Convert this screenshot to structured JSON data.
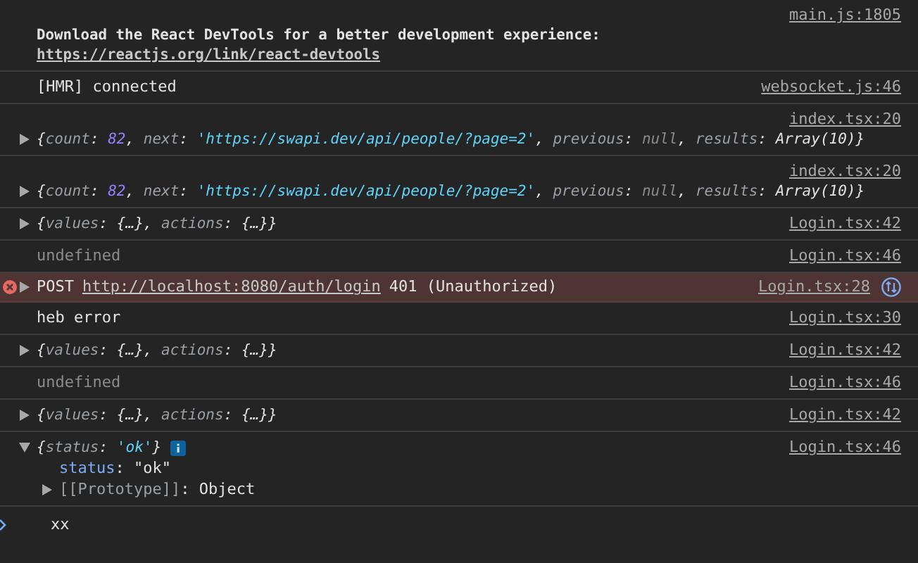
{
  "console": {
    "messages": [
      {
        "kind": "text",
        "bold": true,
        "source": "main.js:1805",
        "text": "Download the React DevTools for a better development experience:",
        "link": "https://reactjs.org/link/react-devtools"
      },
      {
        "kind": "text",
        "bold": false,
        "source": "websocket.js:46",
        "text": "[HMR] connected"
      },
      {
        "kind": "object",
        "expanded": false,
        "source": "index.tsx:20",
        "segments": [
          {
            "text": "{",
            "kind": "punct"
          },
          {
            "text": "count",
            "kind": "key"
          },
          {
            "text": ": ",
            "kind": "punct"
          },
          {
            "text": "82",
            "kind": "number"
          },
          {
            "text": ", ",
            "kind": "punct"
          },
          {
            "text": "next",
            "kind": "key"
          },
          {
            "text": ": ",
            "kind": "punct"
          },
          {
            "text": "'https://swapi.dev/api/people/?page=2'",
            "kind": "string"
          },
          {
            "text": ", ",
            "kind": "punct"
          },
          {
            "text": "previous",
            "kind": "key"
          },
          {
            "text": ": ",
            "kind": "punct"
          },
          {
            "text": "null",
            "kind": "null"
          },
          {
            "text": ", ",
            "kind": "punct"
          },
          {
            "text": "results",
            "kind": "key"
          },
          {
            "text": ": ",
            "kind": "punct"
          },
          {
            "text": "Array(10)",
            "kind": "punct"
          },
          {
            "text": "}",
            "kind": "punct"
          }
        ]
      },
      {
        "kind": "object",
        "expanded": false,
        "source": "index.tsx:20",
        "segments": [
          {
            "text": "{",
            "kind": "punct"
          },
          {
            "text": "count",
            "kind": "key"
          },
          {
            "text": ": ",
            "kind": "punct"
          },
          {
            "text": "82",
            "kind": "number"
          },
          {
            "text": ", ",
            "kind": "punct"
          },
          {
            "text": "next",
            "kind": "key"
          },
          {
            "text": ": ",
            "kind": "punct"
          },
          {
            "text": "'https://swapi.dev/api/people/?page=2'",
            "kind": "string"
          },
          {
            "text": ", ",
            "kind": "punct"
          },
          {
            "text": "previous",
            "kind": "key"
          },
          {
            "text": ": ",
            "kind": "punct"
          },
          {
            "text": "null",
            "kind": "null"
          },
          {
            "text": ", ",
            "kind": "punct"
          },
          {
            "text": "results",
            "kind": "key"
          },
          {
            "text": ": ",
            "kind": "punct"
          },
          {
            "text": "Array(10)",
            "kind": "punct"
          },
          {
            "text": "}",
            "kind": "punct"
          }
        ]
      },
      {
        "kind": "object",
        "expanded": false,
        "source": "Login.tsx:42",
        "segments": [
          {
            "text": "{",
            "kind": "punct"
          },
          {
            "text": "values",
            "kind": "key"
          },
          {
            "text": ": ",
            "kind": "punct"
          },
          {
            "text": "{…}",
            "kind": "punct"
          },
          {
            "text": ", ",
            "kind": "punct"
          },
          {
            "text": "actions",
            "kind": "key"
          },
          {
            "text": ": ",
            "kind": "punct"
          },
          {
            "text": "{…}",
            "kind": "punct"
          },
          {
            "text": "}",
            "kind": "punct"
          }
        ]
      },
      {
        "kind": "undefined",
        "source": "Login.tsx:46",
        "text": "undefined"
      },
      {
        "kind": "error",
        "expanded": false,
        "source": "Login.tsx:28",
        "method": "POST",
        "url": "http://localhost:8080/auth/login",
        "status": "401 (Unauthorized)"
      },
      {
        "kind": "text",
        "bold": false,
        "source": "Login.tsx:30",
        "text": "heb error"
      },
      {
        "kind": "object",
        "expanded": false,
        "source": "Login.tsx:42",
        "segments": [
          {
            "text": "{",
            "kind": "punct"
          },
          {
            "text": "values",
            "kind": "key"
          },
          {
            "text": ": ",
            "kind": "punct"
          },
          {
            "text": "{…}",
            "kind": "punct"
          },
          {
            "text": ", ",
            "kind": "punct"
          },
          {
            "text": "actions",
            "kind": "key"
          },
          {
            "text": ": ",
            "kind": "punct"
          },
          {
            "text": "{…}",
            "kind": "punct"
          },
          {
            "text": "}",
            "kind": "punct"
          }
        ]
      },
      {
        "kind": "undefined",
        "source": "Login.tsx:46",
        "text": "undefined"
      },
      {
        "kind": "object",
        "expanded": false,
        "source": "Login.tsx:42",
        "segments": [
          {
            "text": "{",
            "kind": "punct"
          },
          {
            "text": "values",
            "kind": "key"
          },
          {
            "text": ": ",
            "kind": "punct"
          },
          {
            "text": "{…}",
            "kind": "punct"
          },
          {
            "text": ", ",
            "kind": "punct"
          },
          {
            "text": "actions",
            "kind": "key"
          },
          {
            "text": ": ",
            "kind": "punct"
          },
          {
            "text": "{…}",
            "kind": "punct"
          },
          {
            "text": "}",
            "kind": "punct"
          }
        ]
      },
      {
        "kind": "object",
        "expanded": true,
        "source": "Login.tsx:46",
        "segments": [
          {
            "text": "{",
            "kind": "punct"
          },
          {
            "text": "status",
            "kind": "key"
          },
          {
            "text": ": ",
            "kind": "punct"
          },
          {
            "text": "'ok'",
            "kind": "string"
          },
          {
            "text": "}",
            "kind": "punct"
          }
        ],
        "children": [
          {
            "kind": "property",
            "segments": [
              {
                "text": "status",
                "kind": "prop"
              },
              {
                "text": ": ",
                "kind": "plain"
              },
              {
                "text": "\"ok\"",
                "kind": "plain"
              }
            ]
          },
          {
            "kind": "prototype",
            "expanded": false,
            "segments": [
              {
                "text": "[[Prototype]]",
                "kind": "proto"
              },
              {
                "text": ": ",
                "kind": "plain"
              },
              {
                "text": "Object",
                "kind": "plain"
              }
            ]
          }
        ]
      }
    ],
    "prompt": {
      "value": "xx"
    }
  }
}
